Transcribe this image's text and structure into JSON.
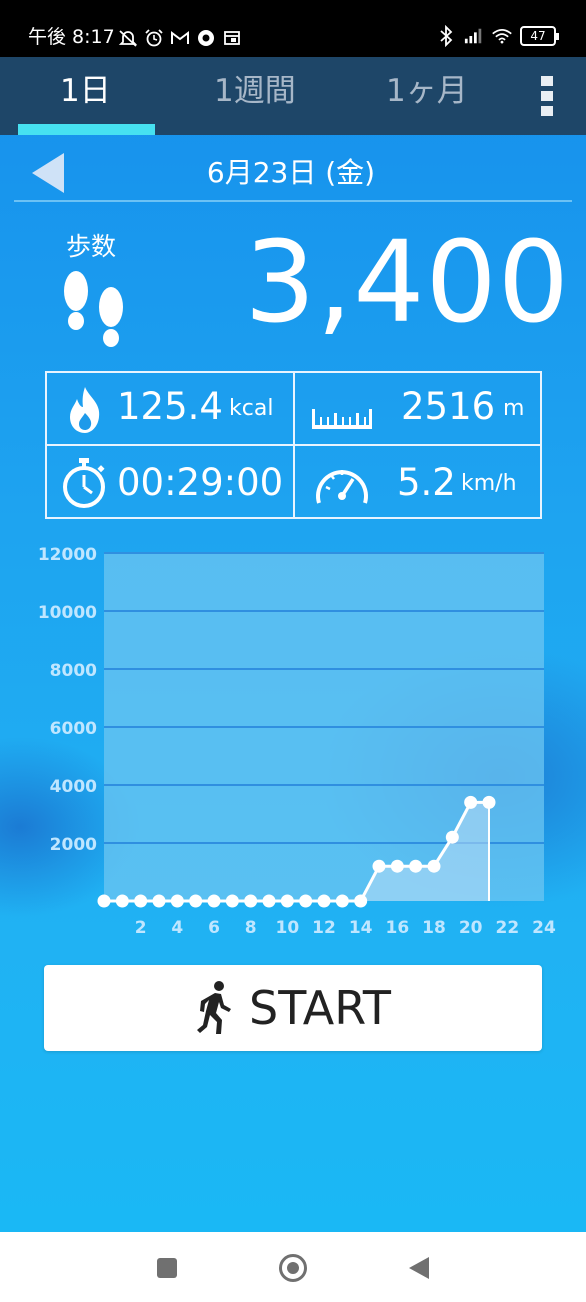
{
  "status_bar": {
    "time": "午後 8:17",
    "battery": "47",
    "icons_left": [
      "mute-icon",
      "alarm-icon",
      "gmail-icon",
      "chrome-icon",
      "calendar-icon"
    ],
    "icons_right": [
      "bluetooth-icon",
      "signal-icon",
      "wifi-icon",
      "battery-icon"
    ]
  },
  "tabs": [
    {
      "label": "1日",
      "active": true
    },
    {
      "label": "1週間",
      "active": false
    },
    {
      "label": "1ヶ月",
      "active": false
    }
  ],
  "date": "6月23日 (金)",
  "steps": {
    "label": "歩数",
    "value": "3,400"
  },
  "stats": {
    "calories": {
      "value": "125.4",
      "unit": "kcal",
      "icon": "fire-icon"
    },
    "distance": {
      "value": "2516",
      "unit": "m",
      "icon": "ruler-icon"
    },
    "time": {
      "value": "00:29:00",
      "icon": "stopwatch-icon"
    },
    "speed": {
      "value": "5.2",
      "unit": "km/h",
      "icon": "speedometer-icon"
    }
  },
  "chart_data": {
    "type": "line",
    "x": [
      0,
      1,
      2,
      3,
      4,
      5,
      6,
      7,
      8,
      9,
      10,
      11,
      12,
      13,
      14,
      15,
      16,
      17,
      18,
      19,
      20,
      21
    ],
    "values": [
      0,
      0,
      0,
      0,
      0,
      0,
      0,
      0,
      0,
      0,
      0,
      0,
      0,
      0,
      0,
      1200,
      1200,
      1200,
      1200,
      2200,
      3400,
      3400
    ],
    "xticks": [
      "2",
      "4",
      "6",
      "8",
      "10",
      "12",
      "14",
      "16",
      "18",
      "20",
      "22",
      "24"
    ],
    "yticks": [
      "2000",
      "4000",
      "6000",
      "8000",
      "10000",
      "12000"
    ],
    "xlim": [
      0,
      24
    ],
    "ylim": [
      0,
      12000
    ],
    "grid": true,
    "colors": {
      "line": "#ffffff",
      "fill": "#b9dcf5",
      "plot_bg": "#6cc6f2",
      "grid": "#2f8fe0",
      "tick": "#bfe6ff"
    }
  },
  "start_button": {
    "label": "START",
    "icon": "walking-icon"
  },
  "nav": [
    "recents-button",
    "home-button",
    "back-button"
  ]
}
